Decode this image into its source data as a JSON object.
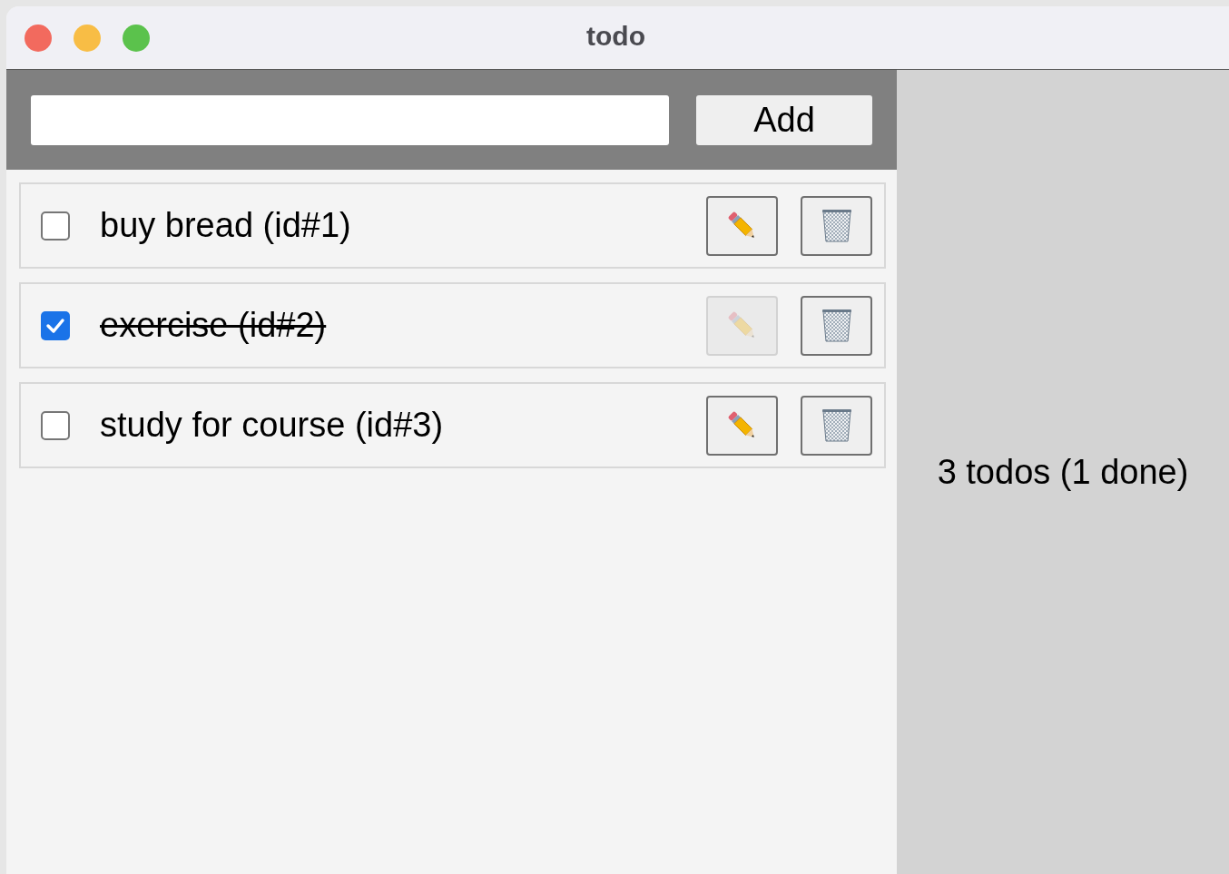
{
  "window": {
    "title": "todo"
  },
  "add_button": "Add",
  "todos": [
    {
      "label": "buy bread (id#1)",
      "done": false,
      "edit_disabled": false
    },
    {
      "label": "exercise (id#2)",
      "done": true,
      "edit_disabled": true
    },
    {
      "label": "study for course (id#3)",
      "done": false,
      "edit_disabled": false
    }
  ],
  "summary": "3 todos (1 done)"
}
